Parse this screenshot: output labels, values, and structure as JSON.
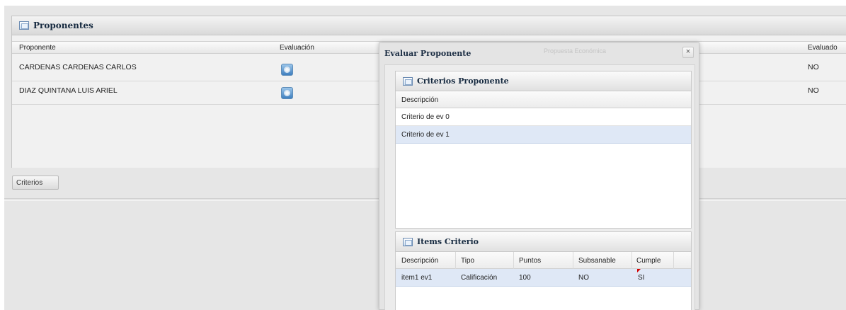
{
  "panel": {
    "title": "Proponentes"
  },
  "grid": {
    "columns": {
      "proponente": "Proponente",
      "evaluacion": "Evaluación",
      "evaluado": "Evaluado"
    },
    "rows": [
      {
        "proponente": "CARDENAS CARDENAS CARLOS",
        "evaluado": "NO"
      },
      {
        "proponente": "DIAZ QUINTANA LUIS ARIEL",
        "evaluado": "NO"
      }
    ]
  },
  "tabs": {
    "criterios": "Criterios"
  },
  "dialog": {
    "title": "Evaluar Proponente",
    "ghost_title": "Propuesta Económica",
    "close": "×",
    "criterios": {
      "title": "Criterios Proponente",
      "header": "Descripción",
      "rows": [
        "Criterio de ev 0",
        "Criterio de ev 1"
      ],
      "selected_index": 1
    },
    "items": {
      "title": "Items Criterio",
      "columns": {
        "descripcion": "Descripción",
        "tipo": "Tipo",
        "puntos": "Puntos",
        "subsanable": "Subsanable",
        "cumple": "Cumple"
      },
      "rows": [
        {
          "descripcion": "item1 ev1",
          "tipo": "Calificación",
          "puntos": "100",
          "subsanable": "NO",
          "cumple": "SI"
        }
      ]
    }
  },
  "icons": {
    "panel": "panel-icon",
    "evaluate": "gear-icon",
    "dirty_cell": "red-flag-icon"
  },
  "colors": {
    "selection": "#dfe8f6",
    "title_text": "#15293f",
    "dirty_flag": "#d40000"
  }
}
